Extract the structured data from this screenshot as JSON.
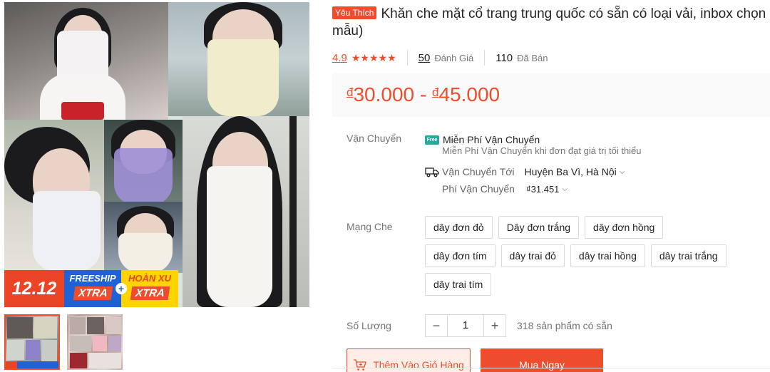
{
  "product": {
    "badge": "Yêu Thích",
    "title": "Khăn che mặt cổ trang trung quốc có sẵn có loại vải, inbox chọn mẫu)"
  },
  "stats": {
    "rating": "4.9",
    "stars": "★★★★★",
    "reviews_count": "50",
    "reviews_label": "Đánh Giá",
    "sold_count": "110",
    "sold_label": "Đã Bán"
  },
  "price": {
    "currency": "đ",
    "min": "30.000",
    "separator": "-",
    "max": "45.000"
  },
  "shipping": {
    "label": "Vận Chuyển",
    "free_icon_text": "Free",
    "free_title": "Miễn Phí Vận Chuyển",
    "free_desc": "Miễn Phí Vận Chuyển khi đơn đạt giá trị tối thiểu",
    "to_label": "Vận Chuyển Tới",
    "to_value": "Huyện Ba Vì, Hà Nội",
    "fee_label": "Phí Vận Chuyển",
    "fee_value": "₫31.451"
  },
  "variant": {
    "label": "Mạng Che",
    "options": [
      "dây đơn đỏ",
      "Dây đơn trắng",
      "dây đơn hồng",
      "dây đơn tím",
      "dây trai đỏ",
      "dây trai hồng",
      "dây trai trắng",
      "dây trai tím"
    ]
  },
  "quantity": {
    "label": "Số Lượng",
    "minus": "−",
    "value": "1",
    "plus": "+",
    "stock": "318 sản phẩm có sẵn"
  },
  "buttons": {
    "add_to_cart": "Thêm Vào Giỏ Hàng",
    "buy_now": "Mua Ngay"
  },
  "promo": {
    "sale": "12.12",
    "freeship_top": "FREESHIP",
    "freeship_bottom": "XTRA",
    "plus": "+",
    "xu_top": "HOÀN XU",
    "xu_bottom": "XTRA"
  },
  "colors": {
    "accent": "#ee4d2d",
    "free_ship": "#26aa99",
    "promo_blue": "#1f62d8",
    "promo_yellow": "#ffd400"
  }
}
